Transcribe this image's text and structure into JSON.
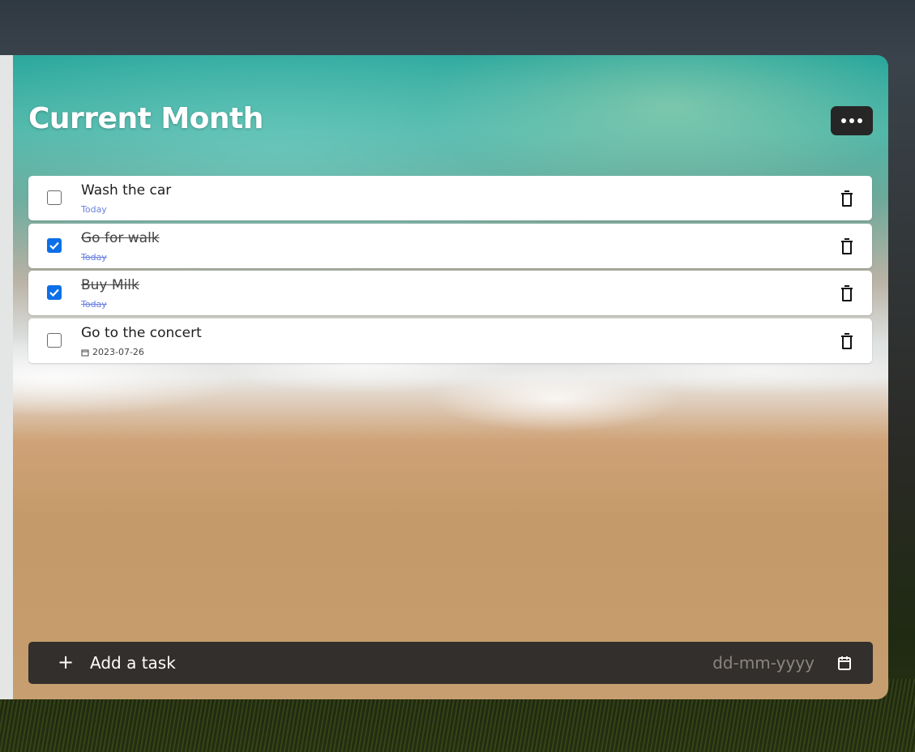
{
  "list": {
    "title": "Current Month",
    "more_icon": "more-horizontal-icon"
  },
  "tasks": [
    {
      "text": "Wash the car",
      "date": "Today",
      "completed": false
    },
    {
      "text": "Go for walk",
      "date": "Today",
      "completed": true
    },
    {
      "text": "Buy Milk",
      "date": "Today",
      "completed": true
    },
    {
      "text": "Go to the concert",
      "date": "2023-07-26",
      "completed": false,
      "date_icon": "calendar-icon"
    }
  ],
  "add_task": {
    "plus_symbol": "+",
    "placeholder": "Add a task",
    "date_placeholder": "dd-mm-yyyy",
    "calendar_icon": "calendar-icon"
  },
  "colors": {
    "accent_checkbox": "#0b6fe8",
    "date_link": "#6a80e0",
    "add_bar": "#332f2c",
    "more_button": "#262626"
  }
}
